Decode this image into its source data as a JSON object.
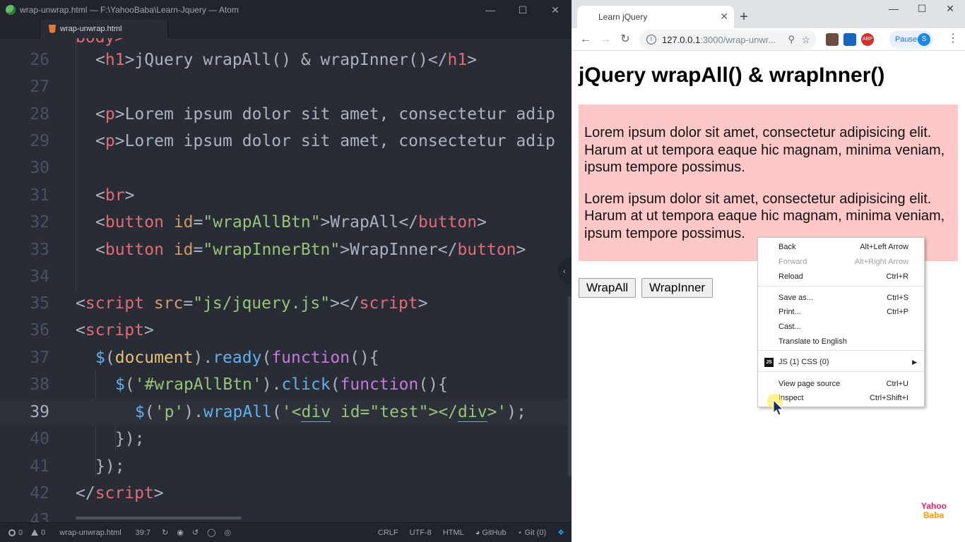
{
  "atom": {
    "window_title": "wrap-unwrap.html — F:\\YahooBaba\\Learn-Jquery — Atom",
    "tab_label": "wrap-unwrap.html",
    "top_line_fragment": "body>",
    "lines": [
      {
        "num": "26"
      },
      {
        "num": "27"
      },
      {
        "num": "28"
      },
      {
        "num": "29"
      },
      {
        "num": "30"
      },
      {
        "num": "31"
      },
      {
        "num": "32"
      },
      {
        "num": "33"
      },
      {
        "num": "34"
      },
      {
        "num": "35"
      },
      {
        "num": "36"
      },
      {
        "num": "37"
      },
      {
        "num": "38"
      },
      {
        "num": "39"
      },
      {
        "num": "40"
      },
      {
        "num": "41"
      },
      {
        "num": "42"
      },
      {
        "num": "43"
      }
    ],
    "code": {
      "h1_text": "jQuery wrapAll() & wrapInner()",
      "p_text": "Lorem ipsum dolor sit amet, consectetur adip",
      "btn1_id": "\"wrapAllBtn\"",
      "btn1_text": "WrapAll",
      "btn2_id": "\"wrapInnerBtn\"",
      "btn2_text": "WrapInner",
      "script_src": "\"js/jquery.js\"",
      "selector_btn": "'#wrapAllBtn'",
      "selector_p": "'p'",
      "wrap_html_start": "'<",
      "wrap_html_mid": " id=\"test\"></",
      "wrap_html_end": ">'",
      "div": "div"
    },
    "status": {
      "errors": "0",
      "warnings": "0",
      "file": "wrap-unwrap.html",
      "cursor": "39:7",
      "line_ending": "CRLF",
      "encoding": "UTF-8",
      "grammar": "HTML",
      "github": "GitHub",
      "git": "Git (0)"
    }
  },
  "chrome": {
    "tab_title": "Learn jQuery",
    "url_host": "127.0.0.1",
    "url_path": ":3000/wrap-unwr...",
    "paused_label": "Paused",
    "avatar_letter": "S",
    "abp_label": "ABP",
    "page": {
      "heading": "jQuery wrapAll() & wrapInner()",
      "paragraph": "Lorem ipsum dolor sit amet, consectetur adipisicing elit. Harum at ut tempora eaque hic magnam, minima veniam, ipsum tempore possimus.",
      "button_wrapall": "WrapAll",
      "button_wrapinner": "WrapInner",
      "wrapper_bg": "#ffc8c8"
    },
    "context_menu": {
      "back": "Back",
      "back_sc": "Alt+Left Arrow",
      "forward": "Forward",
      "forward_sc": "Alt+Right Arrow",
      "reload": "Reload",
      "reload_sc": "Ctrl+R",
      "save_as": "Save as...",
      "save_as_sc": "Ctrl+S",
      "print": "Print...",
      "print_sc": "Ctrl+P",
      "cast": "Cast...",
      "translate": "Translate to English",
      "js_css": "JS (1) CSS (0)",
      "js_badge": "JS",
      "view_source": "View page source",
      "view_source_sc": "Ctrl+U",
      "inspect": "Inspect",
      "inspect_sc": "Ctrl+Shift+I"
    }
  },
  "watermark": {
    "line1": "Yahoo",
    "line2": "Baba"
  }
}
